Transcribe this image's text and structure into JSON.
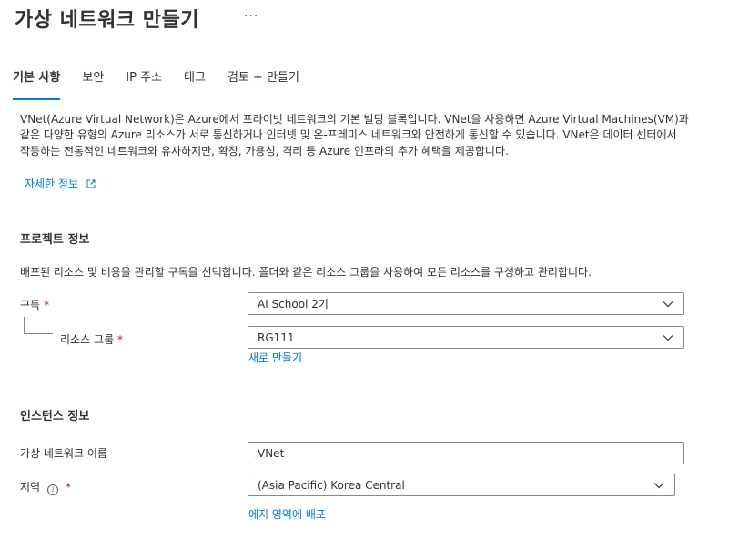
{
  "header": {
    "title": "가상 네트워크 만들기",
    "more_label": "..."
  },
  "tabs": [
    {
      "label": "기본 사항"
    },
    {
      "label": "보안"
    },
    {
      "label": "IP 주소"
    },
    {
      "label": "태그"
    },
    {
      "label": "검토 + 만들기"
    }
  ],
  "intro": {
    "description": "VNet(Azure Virtual Network)은 Azure에서 프라이빗 네트워크의 기본 빌딩 블록입니다. VNet을 사용하면 Azure Virtual Machines(VM)과 같은 다양한 유형의 Azure 리소스가 서로 통신하거나 인터넷 및 온-프레미스 네트워크와 안전하게 통신할 수 있습니다. VNet은 데이터 센터에서 작동하는 전통적인 네트워크와 유사하지만, 확장, 가용성, 격리 등 Azure 인프라의 추가 혜택을 제공합니다.",
    "learn_more_label": "자세한 정보"
  },
  "project": {
    "title": "프로젝트 정보",
    "description": "배포된 리소스 및 비용을 관리할 구독을 선택합니다. 폴더와 같은 리소스 그룹을 사용하여 모든 리소스를 구성하고 관리합니다.",
    "subscription_label": "구독",
    "subscription_value": "AI School 2기",
    "resource_group_label": "리소스 그룹",
    "resource_group_value": "RG111",
    "create_new_label": "새로 만들기"
  },
  "instance": {
    "title": "인스턴스 정보",
    "name_label": "가상 네트워크 이름",
    "name_value": "VNet",
    "region_label": "지역",
    "region_value": "(Asia Pacific) Korea Central",
    "edge_zone_label": "에지 영역에 배포"
  },
  "required_marker": "*",
  "info_glyph": "i",
  "colors": {
    "accent": "#0078d4",
    "required": "#a4262c",
    "text": "#323130",
    "border": "#8a8886"
  },
  "icons": {
    "more": "ellipsis-icon",
    "external": "external-link-icon",
    "dropdown": "chevron-down-icon",
    "info": "info-icon"
  }
}
